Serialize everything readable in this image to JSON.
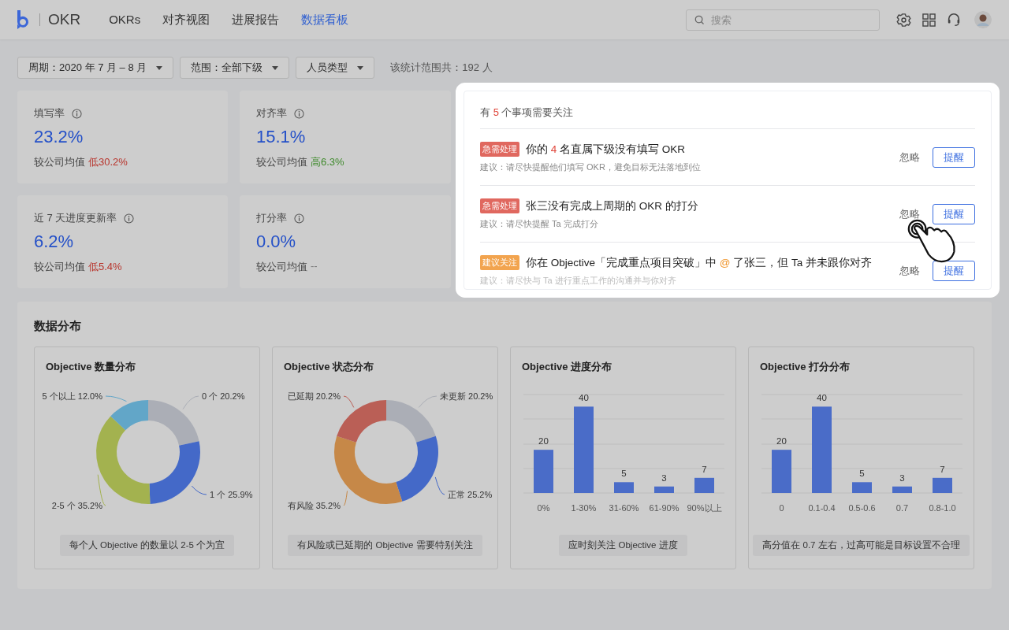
{
  "header": {
    "logo_text": "OKR",
    "nav": [
      {
        "label": "OKRs",
        "selected": false
      },
      {
        "label": "对齐视图",
        "selected": false
      },
      {
        "label": "进展报告",
        "selected": false
      },
      {
        "label": "数据看板",
        "selected": true
      }
    ],
    "search": {
      "placeholder": "搜索"
    }
  },
  "filters": {
    "dropdowns": [
      {
        "label": "周期：2020 年 7 月 – 8 月"
      },
      {
        "label": "范围：全部下级"
      },
      {
        "label": "人员类型"
      }
    ],
    "summary": "该统计范围共：192 人"
  },
  "metrics": [
    {
      "title": "填写率",
      "value": "23.2%",
      "compare_label": "较公司均值",
      "color": "#b8342c",
      "direction": "低",
      "delta": "30.2%"
    },
    {
      "title": "对齐率",
      "value": "15.1%",
      "compare_label": "较公司均值",
      "color": "#3f8a2c",
      "direction": "高",
      "delta": "6.3%"
    },
    {
      "title": "近 7 天进度更新率",
      "value": "6.2%",
      "compare_label": "较公司均值",
      "color": "#b8342c",
      "direction": "低",
      "delta": "5.4%"
    },
    {
      "title": "打分率",
      "value": "0.0%",
      "compare_label": "较公司均值",
      "color": "#777777",
      "delta": "--"
    }
  ],
  "alerts": {
    "heading": [
      {
        "text": "有 "
      },
      {
        "text": "5",
        "color": "#e0453a"
      },
      {
        "text": " 个事项需要关注"
      }
    ],
    "items": [
      {
        "kind": "urgent",
        "tag": "急需处理",
        "title": [
          {
            "text": "你的 "
          },
          {
            "text": "4",
            "color": "#e0453a"
          },
          {
            "text": " 名直属下级没有填写 OKR"
          }
        ],
        "suggestion": "建议：请尽快提醒他们填写 OKR，避免目标无法落地到位",
        "ignore": "忽略",
        "remind": "提醒"
      },
      {
        "kind": "urgent",
        "tag": "急需处理",
        "title": [
          {
            "text": "张三没有完成上周期的 OKR 的打分"
          }
        ],
        "suggestion": "建议：请尽快提醒 Ta 完成打分",
        "ignore": "忽略",
        "remind": "提醒"
      },
      {
        "kind": "suggest",
        "tag": "建议关注",
        "title": [
          {
            "text": "你在 Objective「完成重点项目突破」中 "
          },
          {
            "text": "@",
            "color": "#f0952b"
          },
          {
            "text": " 了张三，但 Ta 并未跟你对齐"
          }
        ],
        "suggestion": "建议：请尽快与 Ta 进行重点工作的沟通并与你对齐",
        "ignore": "忽略",
        "remind": "提醒"
      }
    ]
  },
  "distribution": {
    "title": "数据分布",
    "charts": [
      {
        "title": "Objective 数量分布",
        "note": "每个人 Objective 的数量以 2-5 个为宜",
        "chart_data": {
          "type": "donut",
          "categories": [
            "0 个",
            "1 个",
            "2-5 个",
            "5 个以上"
          ],
          "values": [
            20.2,
            25.9,
            35.2,
            12.0
          ],
          "value_labels": [
            "20.2%",
            "25.9%",
            "35.2%",
            "12.0%"
          ]
        }
      },
      {
        "title": "Objective 状态分布",
        "note": "有风险或已延期的 Objective 需要特别关注",
        "chart_data": {
          "type": "donut",
          "categories": [
            "未更新",
            "正常",
            "有风险",
            "已延期"
          ],
          "values": [
            20.2,
            25.2,
            35.2,
            20.2
          ],
          "value_labels": [
            "20.2%",
            "25.2%",
            "35.2%",
            "20.2%"
          ]
        }
      },
      {
        "title": "Objective 进度分布",
        "note": "应时刻关注 Objective 进度",
        "chart_data": {
          "type": "bar",
          "categories": [
            "0%",
            "1-30%",
            "31-60%",
            "61-90%",
            "90%以上"
          ],
          "values": [
            20,
            40,
            5,
            3,
            7
          ],
          "data_labels": true
        }
      },
      {
        "title": "Objective 打分分布",
        "note": "高分值在 0.7 左右，过高可能是目标设置不合理",
        "chart_data": {
          "type": "bar",
          "categories": [
            "0",
            "0.1-0.4",
            "0.5-0.6",
            "0.7",
            "0.8-1.0"
          ],
          "values": [
            20,
            40,
            5,
            3,
            7
          ],
          "data_labels": true
        }
      }
    ]
  }
}
